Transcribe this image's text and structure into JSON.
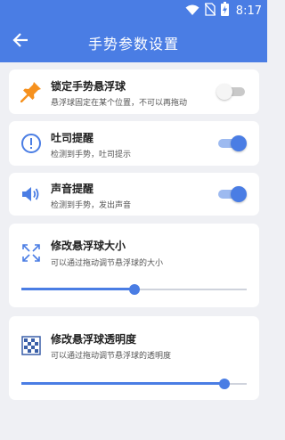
{
  "status_bar": {
    "time": "8:17",
    "battery_icon": "battery-charging-icon",
    "wifi_icon": "wifi-icon",
    "signal_icon": "no-sim-icon"
  },
  "header": {
    "title": "手势参数设置",
    "back_icon": "arrow-back-icon"
  },
  "colors": {
    "accent": "#4a7de4",
    "background": "#eff0f4",
    "pin": "#f6911e"
  },
  "settings": [
    {
      "icon": "pushpin-icon",
      "title": "锁定手势悬浮球",
      "subtitle": "悬浮球固定在某个位置，不可以再拖动",
      "enabled": false
    },
    {
      "icon": "exclamation-circle-icon",
      "title": "吐司提醒",
      "subtitle": "检测到手势，吐司提示",
      "enabled": true
    },
    {
      "icon": "speaker-icon",
      "title": "声音提醒",
      "subtitle": "检测到手势，发出声音",
      "enabled": true
    }
  ],
  "sliders": [
    {
      "icon": "resize-arrows-icon",
      "title": "修改悬浮球大小",
      "subtitle": "可以通过拖动调节悬浮球的大小",
      "value": 0.5
    },
    {
      "icon": "checkerboard-icon",
      "title": "修改悬浮球透明度",
      "subtitle": "可以通过拖动调节悬浮球的透明度",
      "value": 0.9
    }
  ]
}
